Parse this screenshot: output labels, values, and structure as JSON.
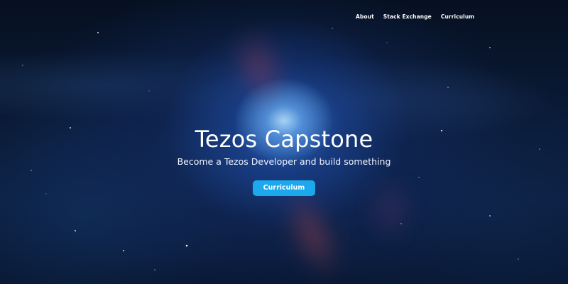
{
  "nav": {
    "items": [
      {
        "label": "About"
      },
      {
        "label": "Stack Exchange"
      },
      {
        "label": "Curriculum"
      }
    ]
  },
  "hero": {
    "title": "Tezos Capstone",
    "subtitle": "Become a Tezos Developer and build something",
    "button_label": "Curriculum"
  },
  "colors": {
    "accent": "#1ba8ec",
    "background": "#0b1d3d",
    "text": "#ffffff"
  }
}
